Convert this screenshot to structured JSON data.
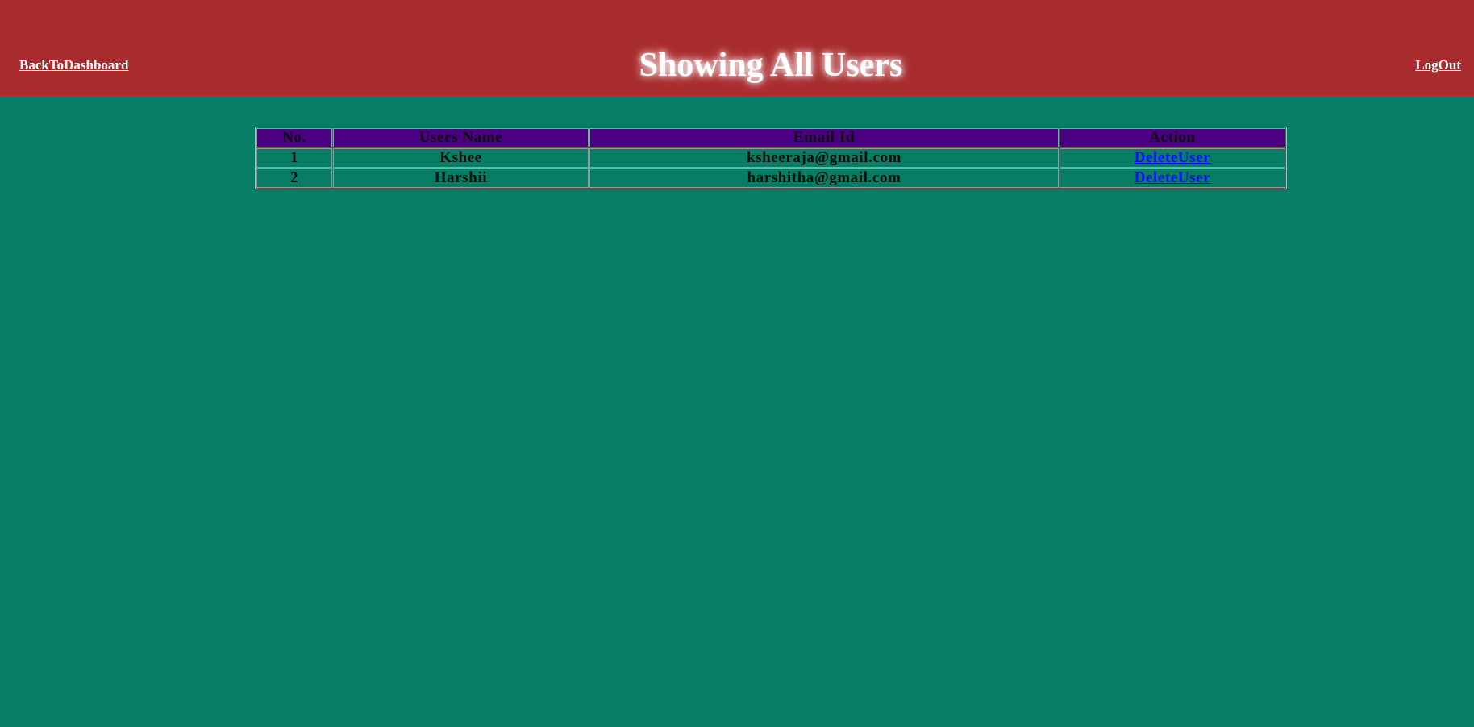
{
  "header": {
    "back_label": "BackToDashboard",
    "title": "Showing All Users",
    "logout_label": "LogOut"
  },
  "colors": {
    "header_bg": "#a82b2d",
    "page_bg": "#077d66",
    "table_header_bg": "#4a0081",
    "link_blue": "#0c0cff"
  },
  "table": {
    "columns": [
      "No.",
      "Users Name",
      "Email Id",
      "Action"
    ],
    "rows": [
      {
        "no": "1",
        "name": "Kshee",
        "email": "ksheeraja@gmail.com",
        "action": "DeleteUser"
      },
      {
        "no": "2",
        "name": "Harshii",
        "email": "harshitha@gmail.com",
        "action": "DeleteUser"
      }
    ]
  }
}
